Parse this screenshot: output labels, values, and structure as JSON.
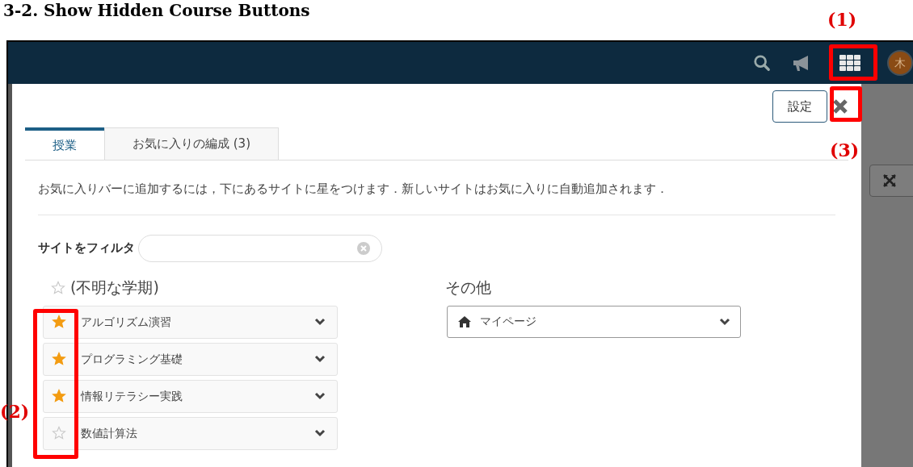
{
  "heading": "3-2. Show Hidden Course Buttons",
  "annotations": [
    "(1)",
    "(2)",
    "(3)"
  ],
  "nav": {
    "avatar": "木"
  },
  "panel": {
    "settings_button": "設定",
    "tabs": [
      {
        "label": "授業",
        "selected": true
      },
      {
        "label": "お気に入りの編成 (3)",
        "selected": false
      }
    ],
    "description": "お気に入りバーに追加するには，下にあるサイトに星をつけます．新しいサイトはお気に入りに自動追加されます．",
    "filter": {
      "label": "サイトをフィルタ"
    },
    "term": {
      "title": "(不明な学期)",
      "starred": false,
      "sites": [
        {
          "name": "アルゴリズム演習",
          "starred": true
        },
        {
          "name": "プログラミング基礎",
          "starred": true
        },
        {
          "name": "情報リテラシー実践",
          "starred": true
        },
        {
          "name": "数値計算法",
          "starred": false
        }
      ]
    },
    "other": {
      "title": "その他",
      "sites": [
        {
          "name": "マイページ"
        }
      ]
    }
  }
}
